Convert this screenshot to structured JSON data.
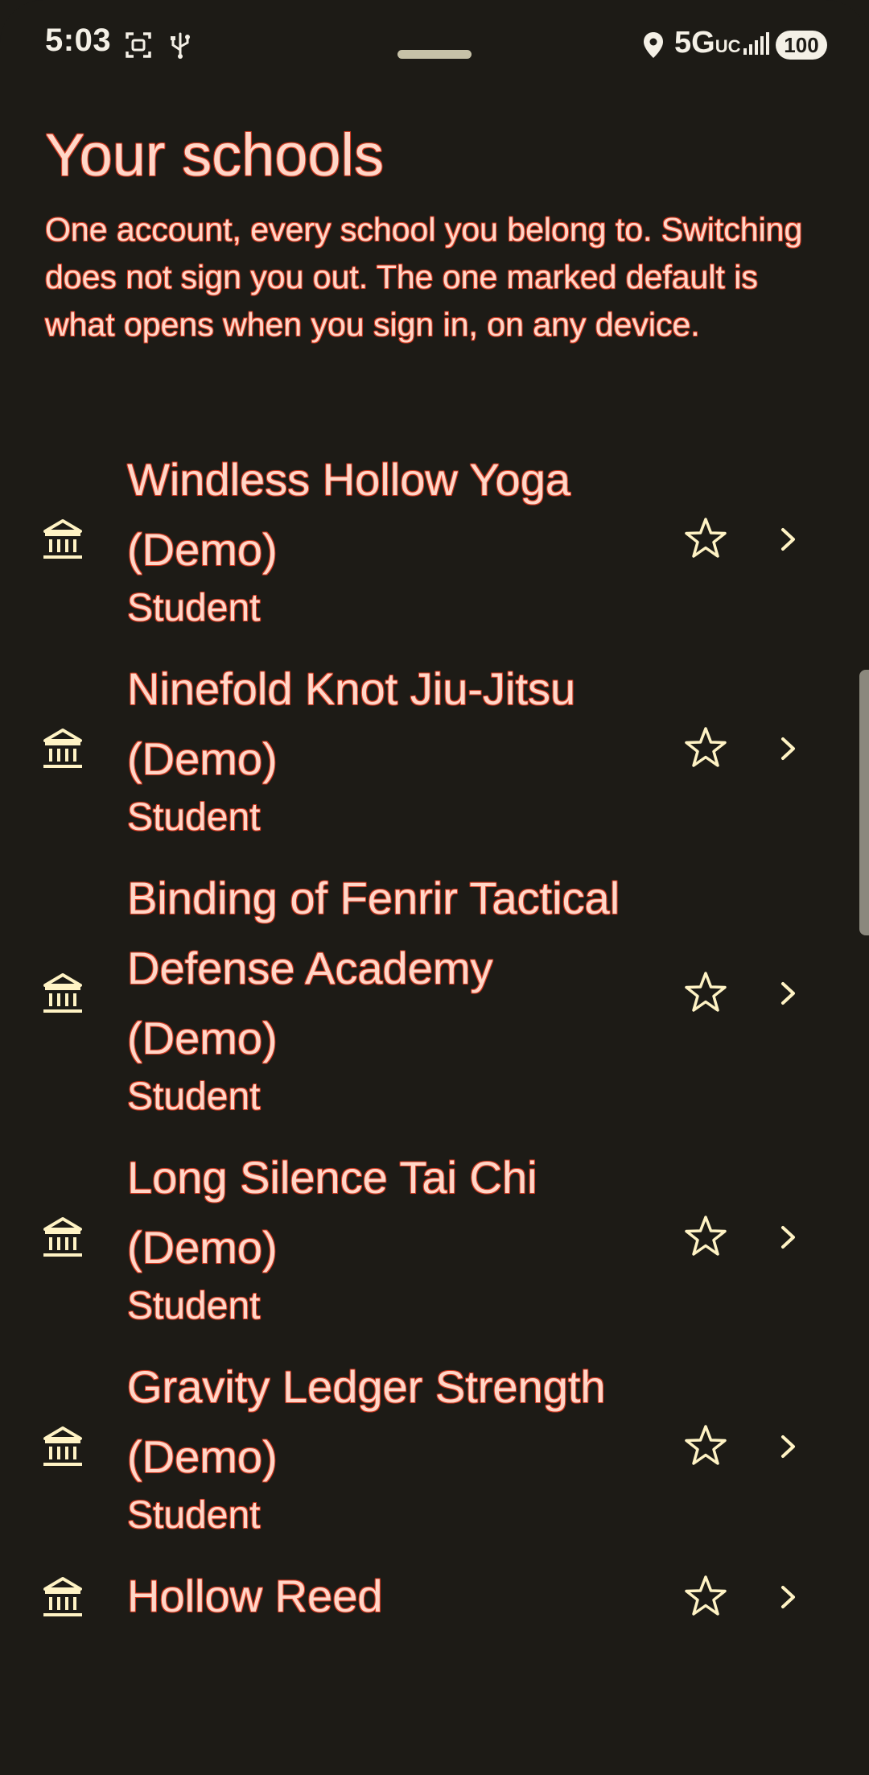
{
  "status_bar": {
    "time": "5:03",
    "network_main": "5G",
    "network_sub": "UC",
    "battery": "100",
    "icons": [
      "screenshot-icon",
      "usb-icon",
      "location-icon",
      "signal-icon"
    ]
  },
  "header": {
    "title": "Your schools",
    "description": "One account, every school you belong to. Switching does not sign you out. The one marked default is what opens when you sign in, on any device."
  },
  "schools": [
    {
      "name": "Windless Hollow Yoga (Demo)",
      "role": "Student",
      "icon": "bank-icon",
      "default": false
    },
    {
      "name": "Ninefold Knot Jiu-Jitsu (Demo)",
      "role": "Student",
      "icon": "bank-icon",
      "default": false
    },
    {
      "name": "Binding of Fenrir Tactical Defense Academy (Demo)",
      "role": "Student",
      "icon": "bank-icon",
      "default": false
    },
    {
      "name": "Long Silence Tai Chi (Demo)",
      "role": "Student",
      "icon": "bank-icon",
      "default": false
    },
    {
      "name": "Gravity Ledger Strength (Demo)",
      "role": "Student",
      "icon": "bank-icon",
      "default": false
    },
    {
      "name": "Hollow Reed",
      "role": "",
      "icon": "bank-icon",
      "default": false
    }
  ],
  "colors": {
    "background": "#1d1b16",
    "text": "#ffd7c8",
    "outline": "#e2452a",
    "icon": "#fff3c4"
  }
}
